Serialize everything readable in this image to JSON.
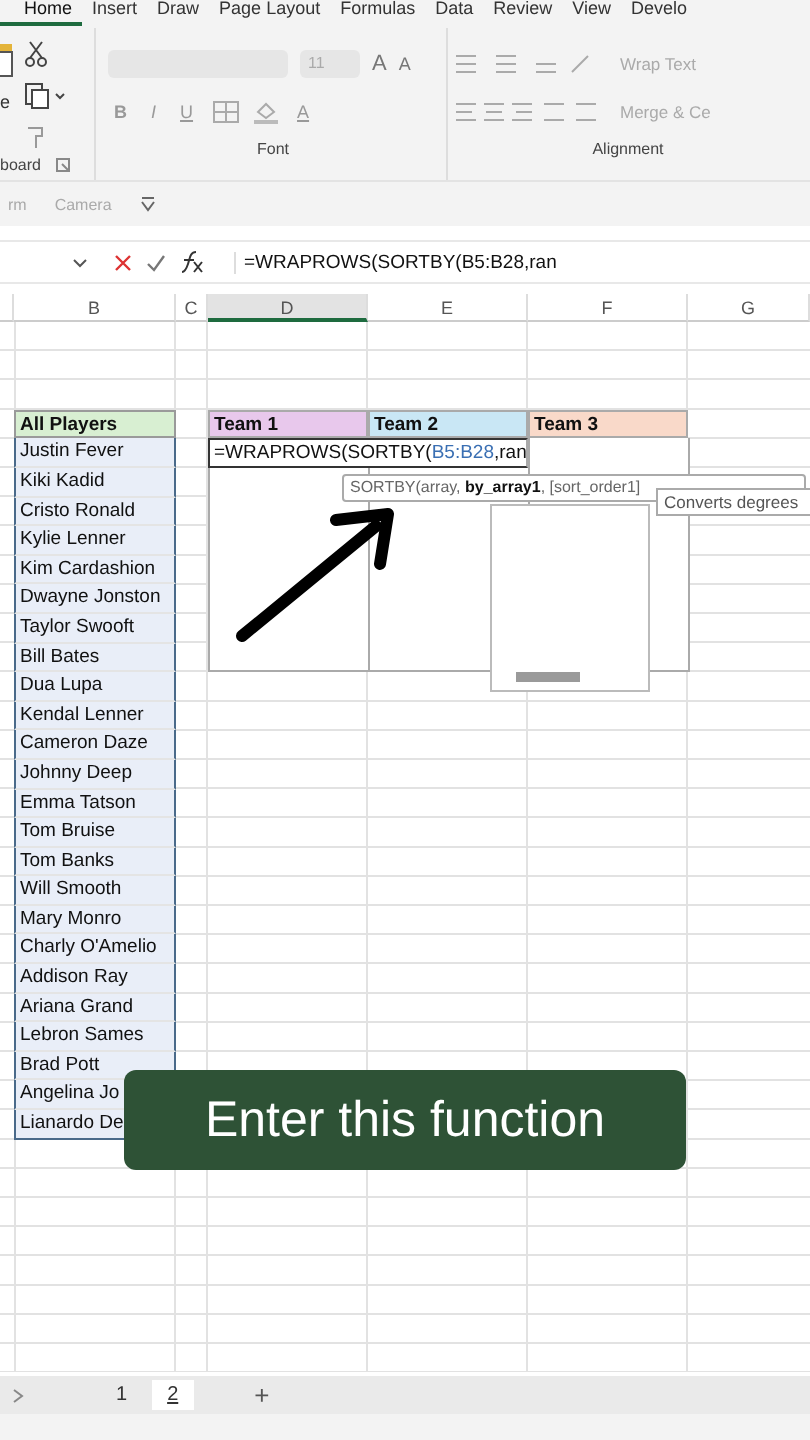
{
  "ribbon": {
    "tabs": [
      {
        "label": "Home",
        "selected": true
      },
      {
        "label": "Insert",
        "selected": false
      },
      {
        "label": "Draw",
        "selected": false
      },
      {
        "label": "Page Layout",
        "selected": false
      },
      {
        "label": "Formulas",
        "selected": false
      },
      {
        "label": "Data",
        "selected": false
      },
      {
        "label": "Review",
        "selected": false
      },
      {
        "label": "View",
        "selected": false
      },
      {
        "label": "Develo",
        "selected": false
      }
    ],
    "clipboard": {
      "paste_label": "e",
      "group_label": "board"
    },
    "font": {
      "size": "11",
      "grow_label": "A",
      "shrink_label": "A",
      "styles": [
        "B",
        "I",
        "U"
      ],
      "color_label": "A",
      "group_label": "Font"
    },
    "alignment": {
      "wrap_text": "Wrap Text",
      "merge": "Merge & Ce",
      "group_label": "Alignment"
    }
  },
  "quick_access": {
    "items": [
      "rm",
      "Camera"
    ]
  },
  "formula_bar": {
    "formula": "=WRAPROWS(SORTBY(B5:B28,ran"
  },
  "columns": [
    "B",
    "C",
    "D",
    "E",
    "F",
    "G"
  ],
  "sheet": {
    "players_header": "All Players",
    "players": [
      "Justin Fever",
      "Kiki Kadid",
      "Cristo Ronald",
      "Kylie Lenner",
      "Kim Cardashion",
      "Dwayne Jonston",
      "Taylor Swooft",
      "Bill Bates",
      "Dua Lupa",
      "Kendal Lenner",
      "Cameron Daze",
      "Johnny Deep",
      "Emma Tatson",
      "Tom Bruise",
      "Tom Banks",
      "Will Smooth",
      "Mary Monro",
      "Charly O'Amelio",
      "Addison Ray",
      "Ariana Grand",
      "Lebron Sames",
      "Brad Pott",
      "Angelina Jo",
      "Lianardo De"
    ],
    "teams": [
      {
        "label": "Team 1",
        "color": "#e8c8ec"
      },
      {
        "label": "Team 2",
        "color": "#c9e7f5"
      },
      {
        "label": "Team 3",
        "color": "#f9d9c9"
      }
    ],
    "edit_cell": {
      "prefix": "=WRAPROWS(SORTBY(",
      "reference": "B5:B28",
      "suffix": ",ran"
    }
  },
  "tooltip": "SORTBY(array, **by_array1**, [sort_order1]",
  "tooltip_2": "Converts degrees",
  "caption": "Enter this function",
  "sheet_tabs": [
    {
      "label": "1",
      "selected": false
    },
    {
      "label": "2",
      "selected": true
    }
  ],
  "new_sheet": "+"
}
